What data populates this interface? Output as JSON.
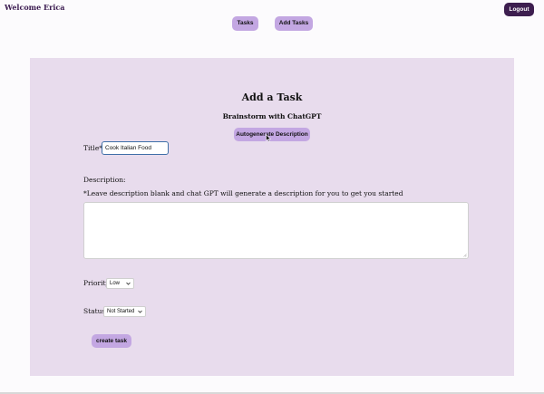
{
  "header": {
    "welcome_text": "Welcome Erica",
    "logout_label": "Logout"
  },
  "nav": {
    "tasks_label": "Tasks",
    "add_tasks_label": "Add Tasks"
  },
  "form": {
    "title": "Add a Task",
    "subtitle": "Brainstorm with ChatGPT",
    "autogen_label": "Autogenerate Description",
    "title_label": "Title*:",
    "title_value": "Cook Italian Food",
    "description_label": "Description:",
    "description_hint": "*Leave description blank and chat GPT will generate a description for you to get you started",
    "description_value": "",
    "priority_label": "Priority:",
    "priority_value": "Low",
    "status_label": "Status:",
    "status_value": "Not Started",
    "submit_label": "create task"
  },
  "colors": {
    "accent": "#c3a7e2",
    "dark_accent": "#3d1e4f",
    "panel_bg": "#e8dced"
  },
  "icons": {
    "cursor": "pointer-cursor-icon",
    "chevron": "chevron-down-icon"
  }
}
